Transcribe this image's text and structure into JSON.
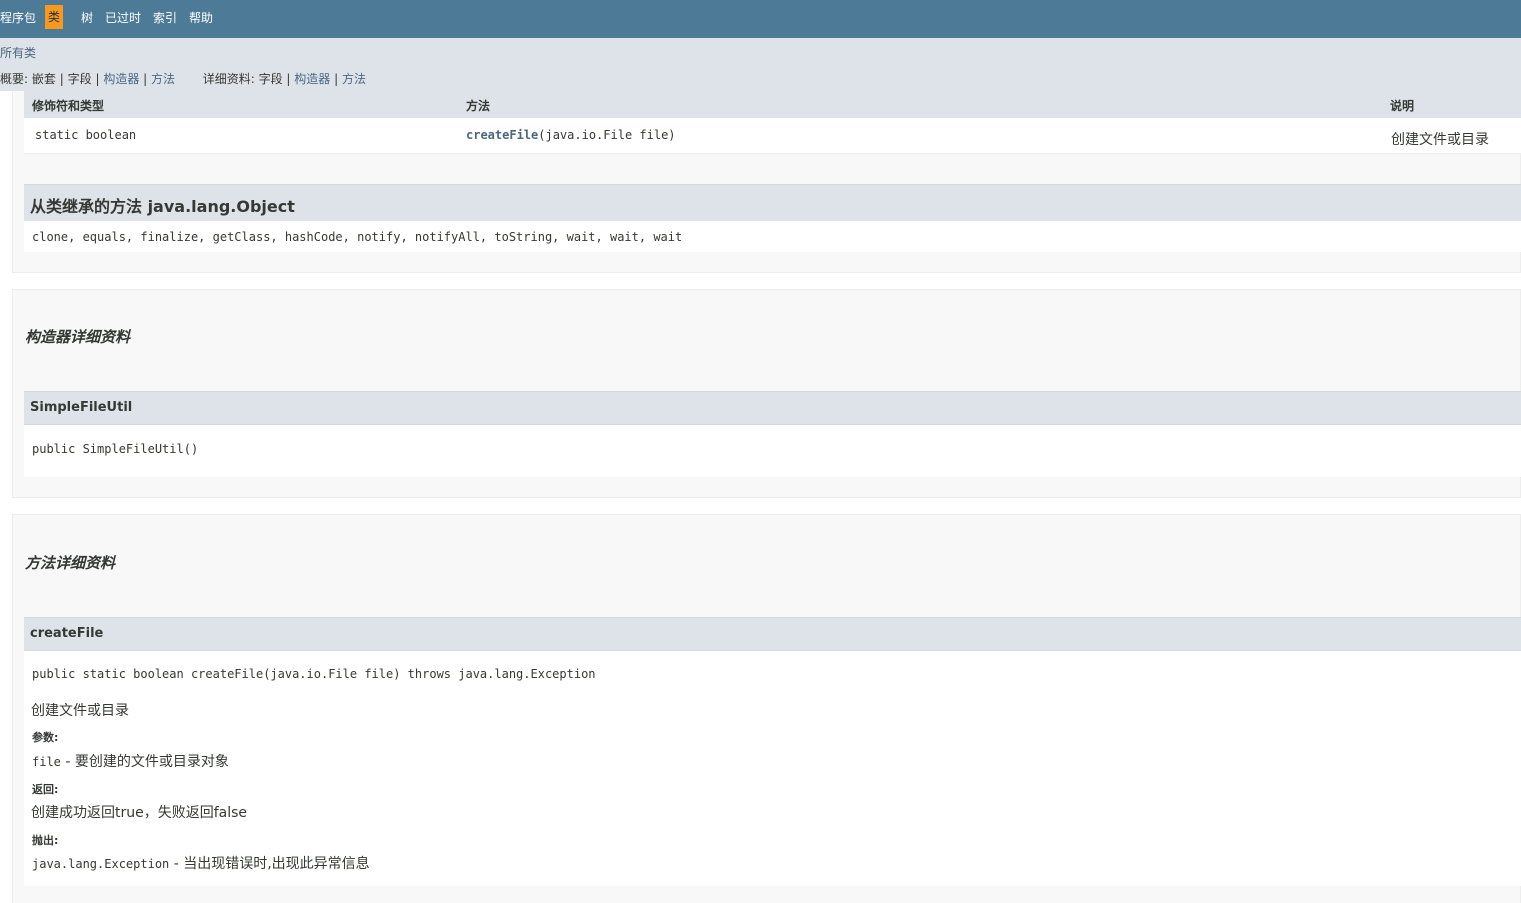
{
  "topnav": {
    "items": [
      "程序包",
      "类",
      "树",
      "已过时",
      "索引",
      "帮助"
    ]
  },
  "subnav": {
    "all_classes": "所有类",
    "summary_label": "概要:",
    "summary_nested": "嵌套",
    "summary_field": "字段",
    "summary_constructor": "构造器",
    "summary_method": "方法",
    "detail_label": "详细资料:",
    "detail_field": "字段",
    "detail_constructor": "构造器",
    "detail_method": "方法",
    "sep": "|"
  },
  "method_summary": {
    "col_modifier": "修饰符和类型",
    "col_method": "方法",
    "col_desc": "说明",
    "rows": [
      {
        "modifier": "static boolean",
        "method_name": "createFile",
        "method_params": "(java.io.File  file)",
        "desc": "创建文件或目录"
      }
    ]
  },
  "inherited": {
    "title": "从类继承的方法 java.lang.Object",
    "methods": "clone, equals, finalize, getClass, hashCode, notify, notifyAll, toString, wait, wait, wait"
  },
  "constructor_detail": {
    "title": "构造器详细资料",
    "name": "SimpleFileUtil",
    "signature": "public  SimpleFileUtil()"
  },
  "method_detail": {
    "title": "方法详细资料",
    "name": "createFile",
    "signature": "public static  boolean  createFile(java.io.File  file) throws java.lang.Exception",
    "description": "创建文件或目录",
    "params_label": "参数:",
    "param_name": "file",
    "param_desc": " - 要创建的文件或目录对象",
    "returns_label": "返回:",
    "returns_desc": "创建成功返回true，失败返回false",
    "throws_label": "抛出:",
    "throws_name": "java.lang.Exception",
    "throws_desc": " - 当出现错误时,出现此异常信息"
  },
  "colors": {
    "topnav_bg": "#4d7a97",
    "active_tab": "#f8981d",
    "header_bg": "#dee3e9",
    "link": "#4a6782"
  }
}
